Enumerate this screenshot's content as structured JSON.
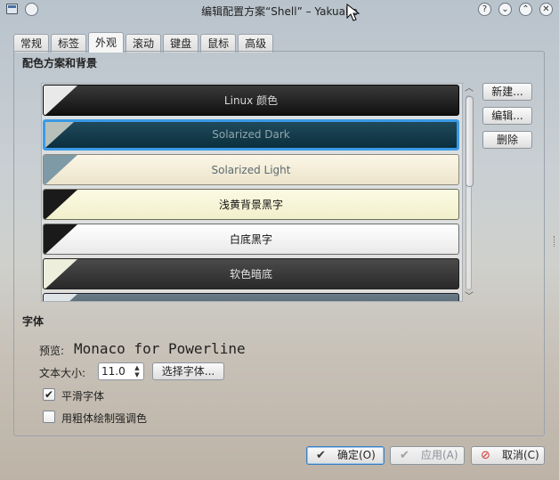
{
  "titlebar": {
    "title": "编辑配置方案“Shell” – Yakuake",
    "help_glyph": "?",
    "min_glyph": "⌄",
    "max_glyph": "⌃",
    "close_glyph": "✕"
  },
  "tabs": [
    {
      "label": "常规"
    },
    {
      "label": "标签"
    },
    {
      "label": "外观",
      "active": true
    },
    {
      "label": "滚动"
    },
    {
      "label": "键盘"
    },
    {
      "label": "鼠标"
    },
    {
      "label": "高级"
    }
  ],
  "color_section": {
    "title": "配色方案和背景",
    "schemes": [
      {
        "name": "Linux 颜色"
      },
      {
        "name": "Solarized Dark",
        "selected": true
      },
      {
        "name": "Solarized Light"
      },
      {
        "name": "浅黄背景黑字"
      },
      {
        "name": "白底黑字"
      },
      {
        "name": "软色暗底"
      },
      {
        "name": ""
      }
    ],
    "scroll_fraction": 0.45,
    "buttons": {
      "new": "新建...",
      "edit": "编辑...",
      "delete": "删除"
    }
  },
  "font_section": {
    "title": "字体",
    "preview_label": "预览:",
    "preview_value": "Monaco for Powerline",
    "size_label": "文本大小:",
    "size_value": "11.0",
    "choose_button": "选择字体...",
    "smooth_label": "平滑字体",
    "smooth_checked": true,
    "bold_label": "用粗体绘制强调色",
    "bold_checked": false
  },
  "footer": {
    "ok": "确定(O)",
    "apply": "应用(A)",
    "cancel": "取消(C)"
  },
  "colors": {
    "selection": "#3a9ae6"
  }
}
